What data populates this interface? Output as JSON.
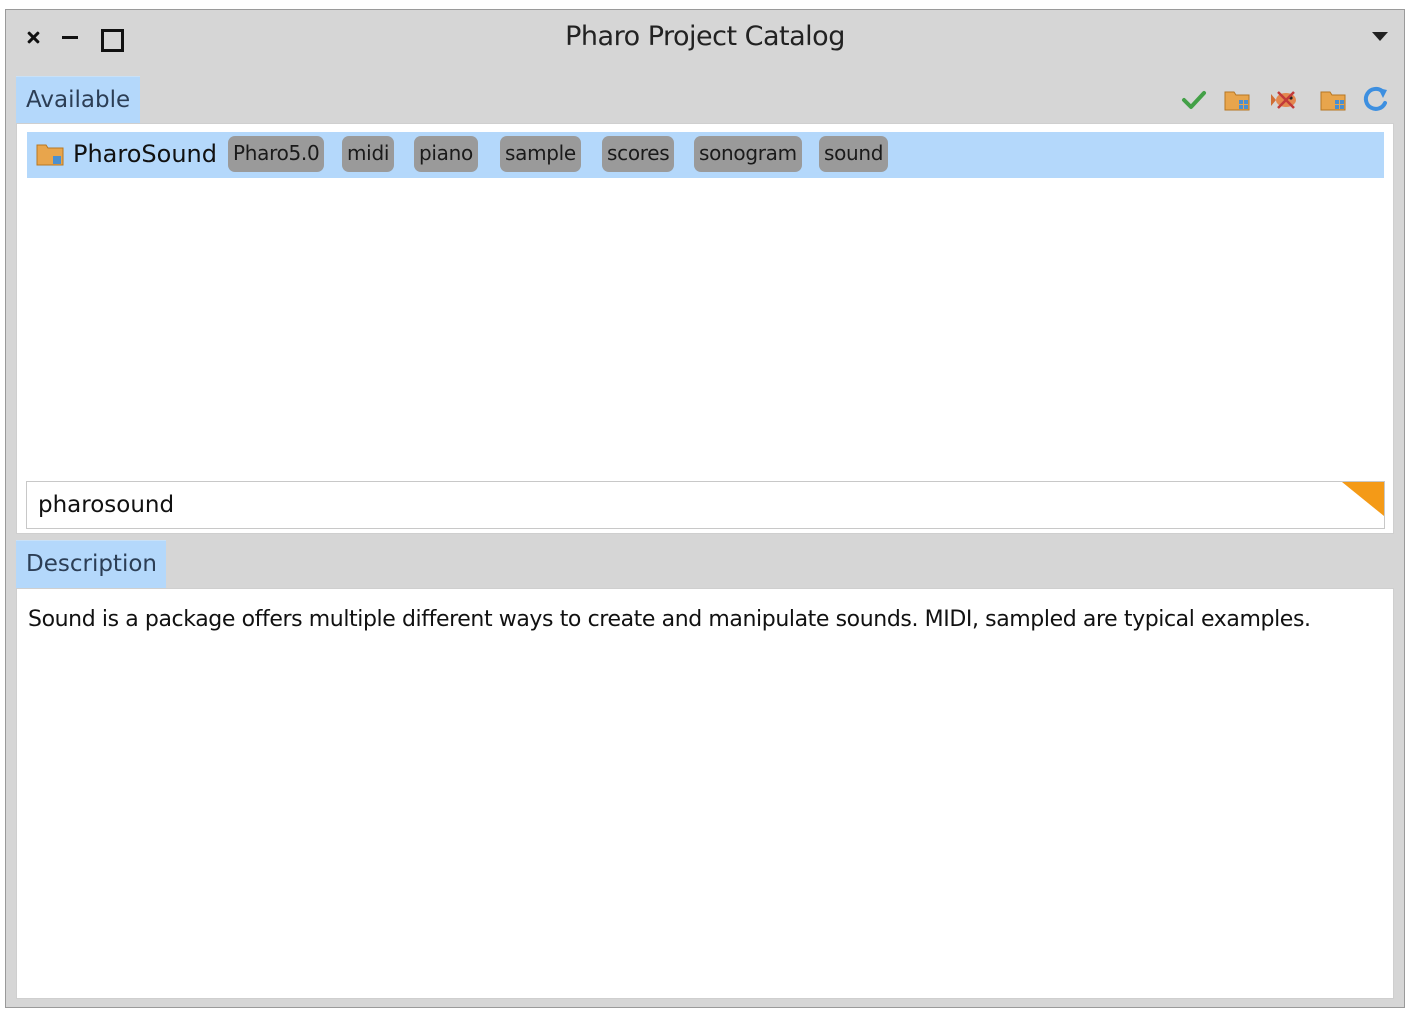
{
  "window": {
    "title": "Pharo Project Catalog"
  },
  "tabs": {
    "available": "Available",
    "description": "Description"
  },
  "toolbar": {
    "icons": [
      "checkmark-icon",
      "load-folder-icon",
      "fish-icon",
      "load-package-folder-icon",
      "refresh-icon"
    ]
  },
  "projects": [
    {
      "name": "PharoSound",
      "selected": true,
      "tags": [
        "Pharo5.0",
        "midi",
        "piano",
        "sample",
        "scores",
        "sonogram",
        "sound"
      ]
    }
  ],
  "search": {
    "value": "pharosound"
  },
  "description": {
    "text": "Sound is a package offers multiple different ways to create and manipulate sounds. MIDI, sampled are typical examples."
  },
  "colors": {
    "selection": "#b4d8fb",
    "tag": "#9a9a9a",
    "accent_orange": "#f49a17",
    "check_green": "#4caf50"
  }
}
